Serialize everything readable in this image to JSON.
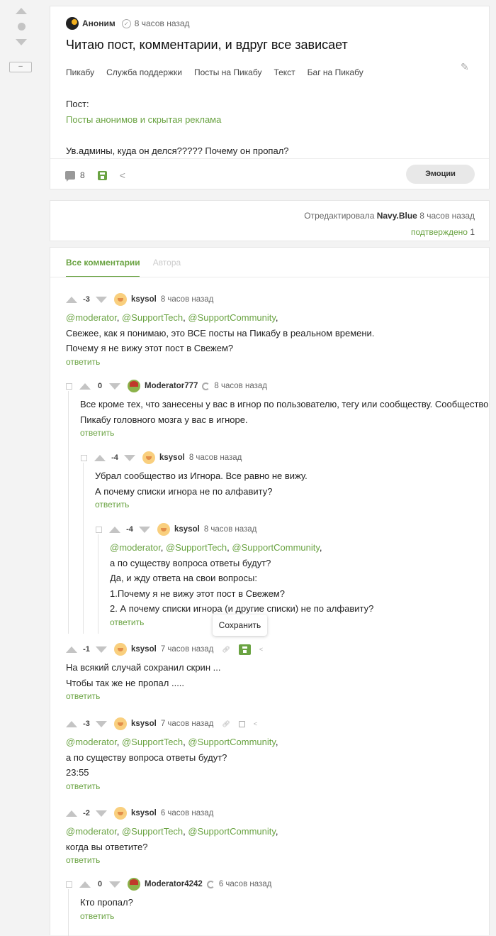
{
  "post": {
    "author": "Аноним",
    "time": "8 часов назад",
    "title": "Читаю пост, комментарии, и вдруг все зависает",
    "tags": [
      "Пикабу",
      "Служба поддержки",
      "Посты на Пикабу",
      "Текст",
      "Баг на Пикабу"
    ],
    "body_label": "Пост:",
    "body_link": "Посты анонимов и скрытая реклама",
    "body_text": "Ув.админы, куда он делся????? Почему он пропал?",
    "comment_count": "8",
    "emotions_label": "Эмоции"
  },
  "rail": {
    "collapse_label": "–"
  },
  "edit": {
    "prefix": "Отредактировала",
    "editor": "Navy.Blue",
    "time": "8 часов назад",
    "confirmed_label": "подтверждено",
    "confirmed_count": "1"
  },
  "tabs": {
    "all": "Все комментарии",
    "author": "Автора"
  },
  "reply_label": "ответить",
  "tooltip": "Сохранить",
  "comments": [
    {
      "rating": "-3",
      "user": "ksysol",
      "time": "8 часов назад",
      "mentions": [
        "@moderator",
        "@SupportTech",
        "@SupportCommunity"
      ],
      "lines": [
        "Свежее, как я понимаю, это ВСЕ посты на Пикабу в реальном времени.",
        "Почему я не вижу этот пост в Свежем?"
      ]
    },
    {
      "rating": "0",
      "user": "Moderator777",
      "time": "8 часов назад",
      "lines": [
        "Все кроме тех, что занесены у вас в игнор по пользователю, тегу или сообществу. Сообщество",
        "Пикабу головного мозга у вас в игноре."
      ]
    },
    {
      "rating": "-4",
      "user": "ksysol",
      "time": "8 часов назад",
      "lines": [
        "Убрал сообщество из Игнора. Все равно не вижу.",
        "А почему списки игнора не по алфавиту?"
      ]
    },
    {
      "rating": "-4",
      "user": "ksysol",
      "time": "8 часов назад",
      "mentions": [
        "@moderator",
        "@SupportTech",
        "@SupportCommunity"
      ],
      "lines": [
        "а по существу вопроса ответы будут?",
        "Да, и жду ответа на свои вопросы:",
        "1.Почему я не вижу этот пост в Свежем?",
        "2. А почему списки игнора (и другие списки) не по алфавиту?"
      ]
    },
    {
      "rating": "-1",
      "user": "ksysol",
      "time": "7 часов назад",
      "lines": [
        "На всякий случай сохранил скрин ...",
        "Чтобы так же не пропал ....."
      ]
    },
    {
      "rating": "-3",
      "user": "ksysol",
      "time": "7 часов назад",
      "mentions": [
        "@moderator",
        "@SupportTech",
        "@SupportCommunity"
      ],
      "lines": [
        "а по существу вопроса ответы будут?",
        "23:55"
      ]
    },
    {
      "rating": "-2",
      "user": "ksysol",
      "time": "6 часов назад",
      "mentions": [
        "@moderator",
        "@SupportTech",
        "@SupportCommunity"
      ],
      "lines": [
        "когда вы ответите?"
      ]
    },
    {
      "rating": "0",
      "user": "Moderator4242",
      "time": "6 часов назад",
      "lines": [
        "Кто пропал?"
      ]
    }
  ]
}
